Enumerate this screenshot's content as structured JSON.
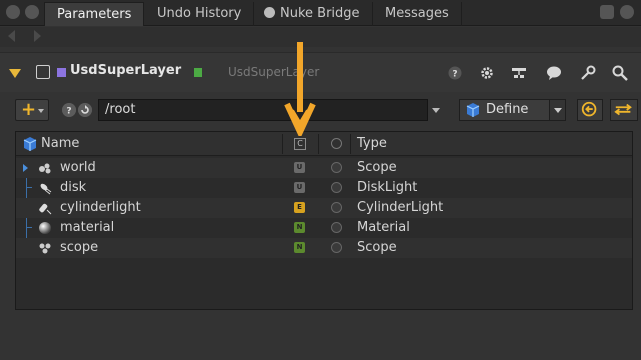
{
  "tabs": [
    {
      "label": "Parameters",
      "active": true
    },
    {
      "label": "Undo History",
      "active": false
    },
    {
      "label": "Nuke Bridge",
      "active": false
    },
    {
      "label": "Messages",
      "active": false
    }
  ],
  "node": {
    "name": "UsdSuperLayer",
    "class_label": "UsdSuperLayer",
    "accent_color": "#8c74e0",
    "status_color": "#4caa44"
  },
  "toolbar": {
    "add_label": "+",
    "path_value": "/root",
    "define_label": "Define"
  },
  "table": {
    "headers": {
      "name": "Name",
      "badge": "C",
      "type": "Type"
    },
    "rows": [
      {
        "name": "world",
        "badge": "U",
        "badge_color": "#6a6a6a",
        "type": "Scope",
        "icon": "scope-icon"
      },
      {
        "name": "disk",
        "badge": "U",
        "badge_color": "#6a6a6a",
        "type": "DiskLight",
        "icon": "disk-light-icon"
      },
      {
        "name": "cylinderlight",
        "badge": "E",
        "badge_color": "#d7a21f",
        "type": "CylinderLight",
        "icon": "cylinder-light-icon"
      },
      {
        "name": "material",
        "badge": "N",
        "badge_color": "#5c8a2e",
        "type": "Material",
        "icon": "material-sphere-icon"
      },
      {
        "name": "scope",
        "badge": "N",
        "badge_color": "#5c8a2e",
        "type": "Scope",
        "icon": "scope-icon"
      }
    ]
  },
  "colors": {
    "accent": "#f0b62c",
    "arrow": "#f2a62a"
  }
}
